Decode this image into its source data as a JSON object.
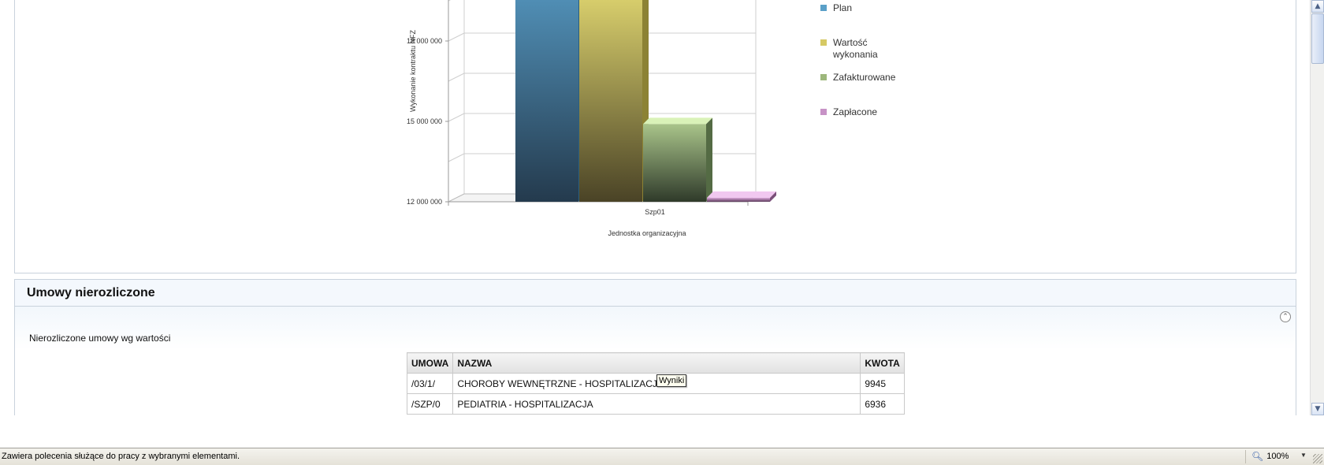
{
  "chart_data": {
    "type": "bar",
    "categories": [
      "Szp01"
    ],
    "series": [
      {
        "name": "Plan",
        "values": [
          22000000
        ],
        "color": "#5aa0c8"
      },
      {
        "name": "Wartość\nwykonania",
        "values": [
          19800000
        ],
        "color": "#d6c964"
      },
      {
        "name": "Zafakturowane",
        "values": [
          14900000
        ],
        "color": "#9db77c"
      },
      {
        "name": "Zapłacone",
        "values": [
          12150000
        ],
        "color": "#c792c6"
      }
    ],
    "ylabel": "Wykonanie kontraktu NFZ",
    "xlabel": "Jednostka organizacyjna",
    "yticks": [
      {
        "value": 12000000,
        "label": "12 000 000"
      },
      {
        "value": 15000000,
        "label": "15 000 000"
      },
      {
        "value": 18000000,
        "label": "18 000 000"
      }
    ],
    "ylim": [
      12000000,
      20100000
    ],
    "legend_position": "right",
    "grid": true
  },
  "umowy": {
    "title": "Umowy nierozliczone",
    "subtitle": "Nierozliczone umowy wg wartości",
    "columns": [
      "UMOWA",
      "NAZWA",
      "KWOTA"
    ],
    "rows": [
      [
        "/03/1/",
        "CHOROBY WEWNĘTRZNE - HOSPITALIZACJA",
        "9945"
      ],
      [
        "/SZP/0",
        "PEDIATRIA - HOSPITALIZACJA",
        "6936"
      ]
    ],
    "collapse_icon": "circle-chevron-up-icon"
  },
  "tooltip": {
    "text": "Wyniki"
  },
  "statusbar": {
    "text": "Zawiera polecenia służące do pracy z wybranymi elementami.",
    "zoom": "100%",
    "zoom_icon": "magnifier-icon"
  }
}
